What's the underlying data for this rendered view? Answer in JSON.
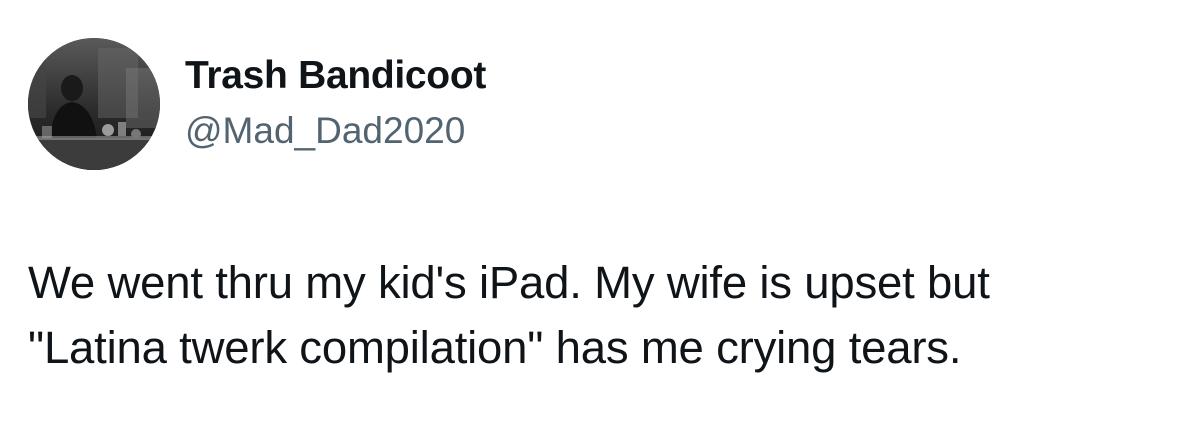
{
  "author": {
    "display_name": "Trash Bandicoot",
    "handle": "@Mad_Dad2020",
    "avatar_icon": "profile-photo-icon"
  },
  "tweet": {
    "lines": [
      "We went thru my kid's iPad. My wife is upset but",
      "\"Latina twerk compilation\" has me crying tears."
    ]
  },
  "colors": {
    "text_primary": "#0f1419",
    "text_secondary": "#536471",
    "background": "#ffffff"
  }
}
